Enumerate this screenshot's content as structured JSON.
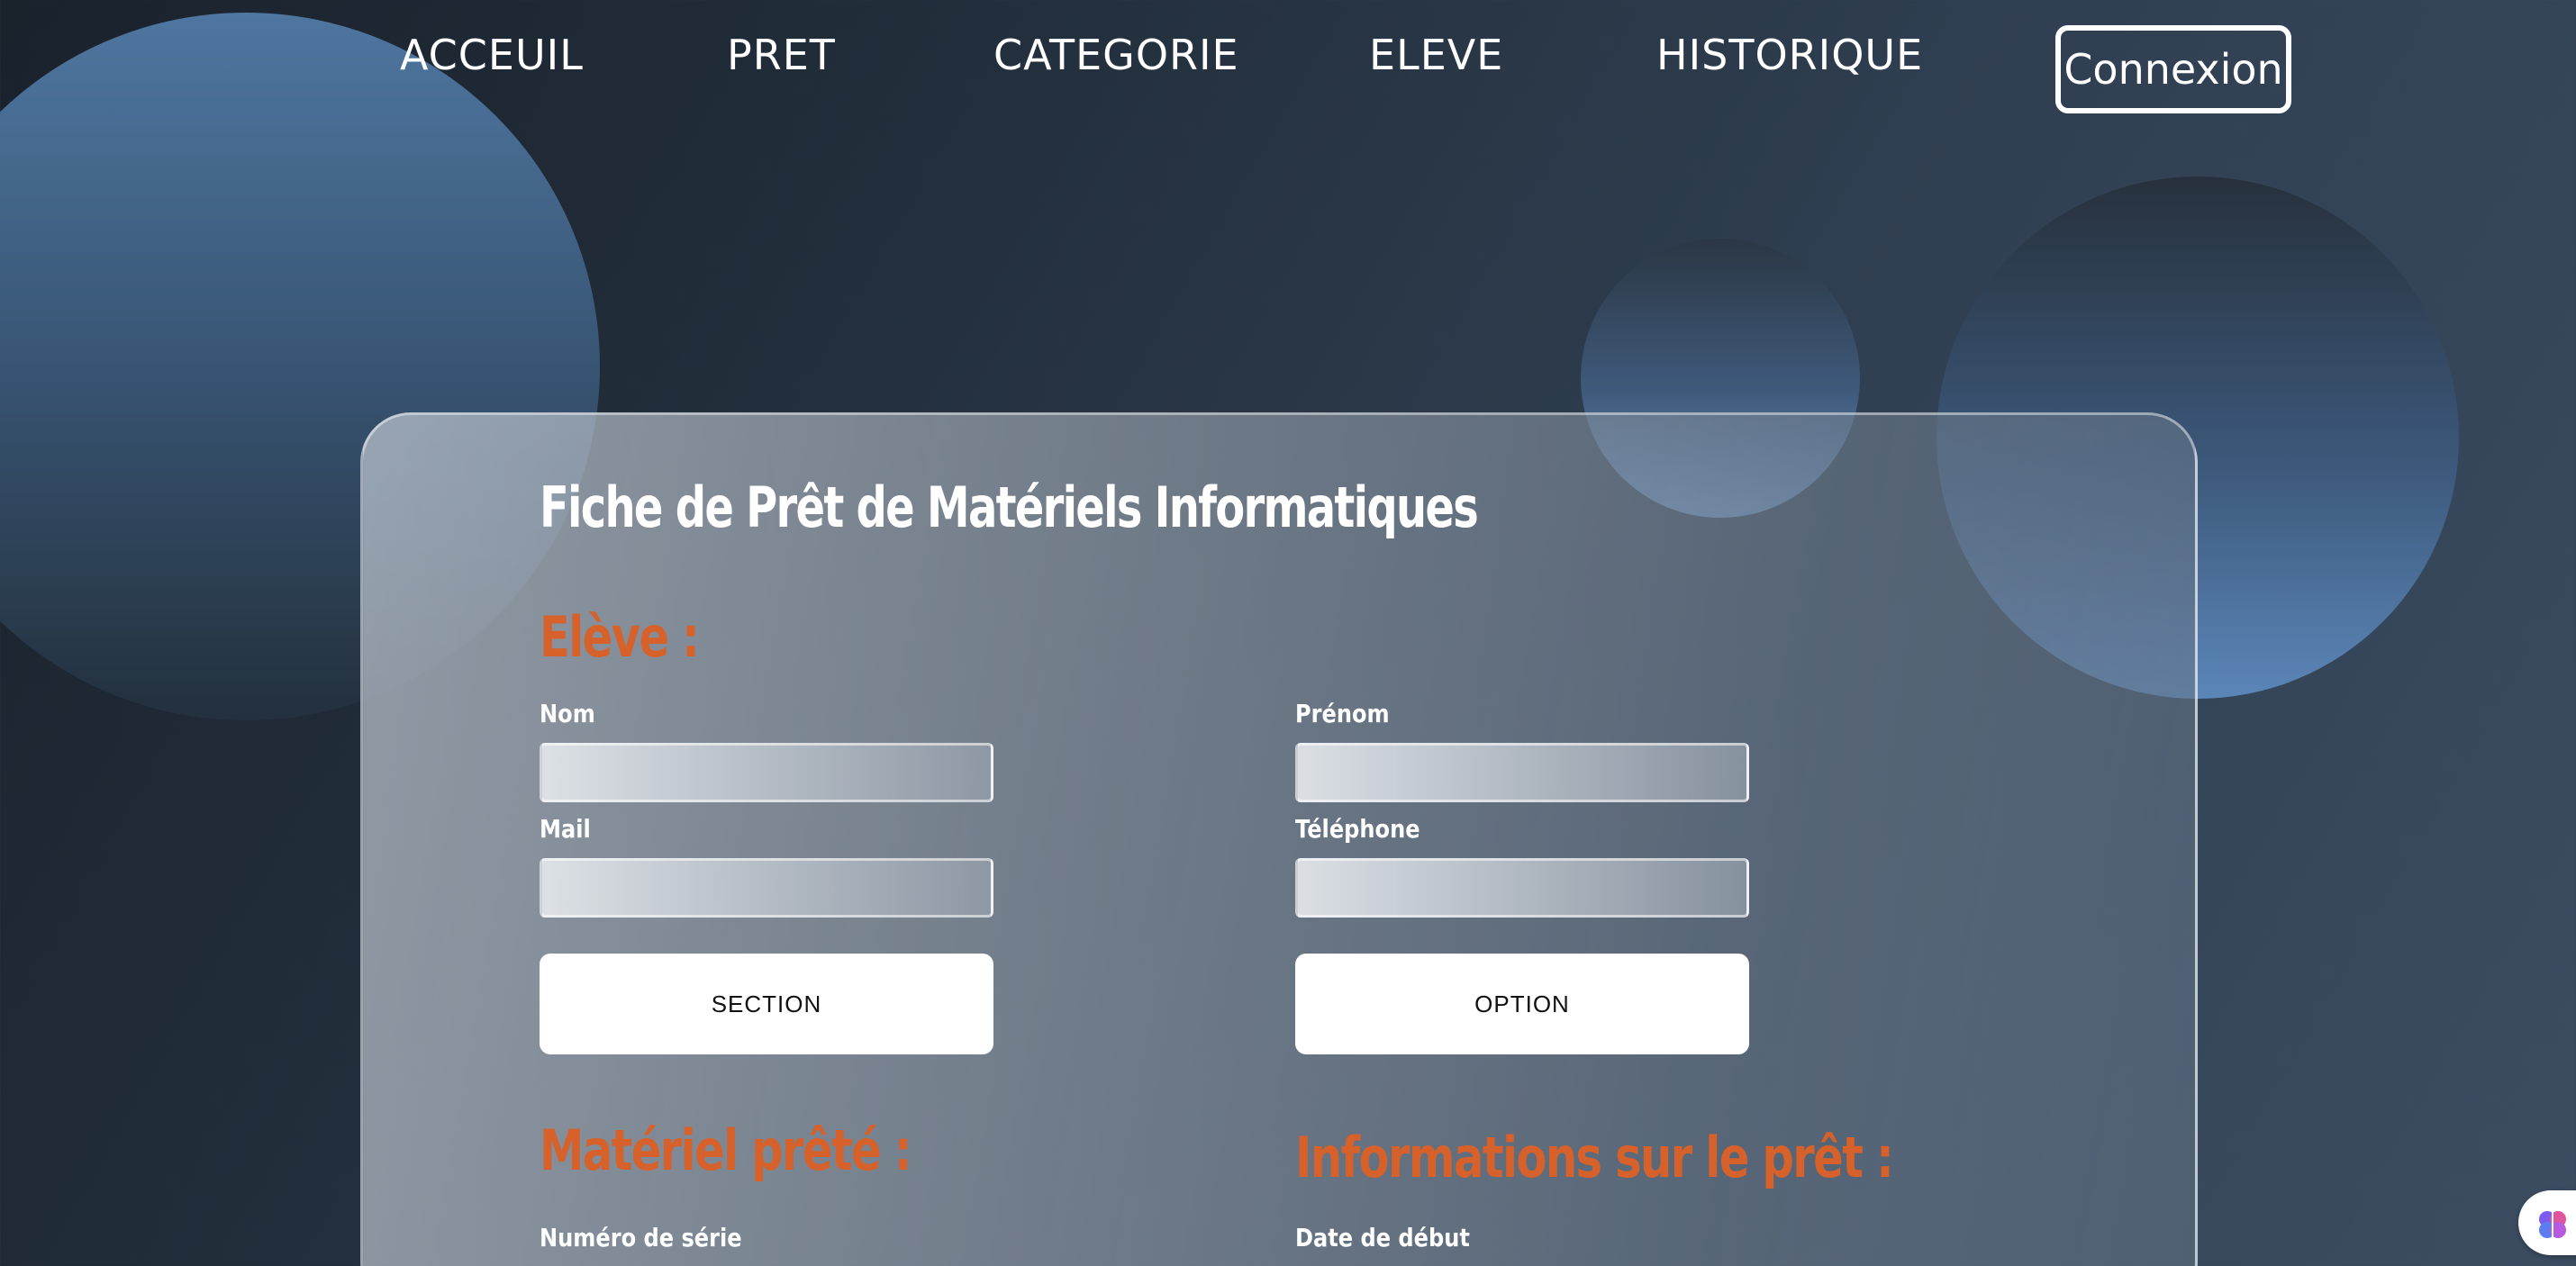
{
  "nav": {
    "links": [
      "ACCEUIL",
      "PRET",
      "CATEGORIE",
      "ELEVE",
      "HISTORIQUE"
    ],
    "login_label": "Connexion"
  },
  "form": {
    "title": "Fiche de Prêt de Matériels Informatiques",
    "student": {
      "heading": "Elève :",
      "nom_label": "Nom",
      "prenom_label": "Prénom",
      "mail_label": "Mail",
      "telephone_label": "Téléphone",
      "section_label": "SECTION",
      "option_label": "OPTION"
    },
    "material": {
      "heading": "Matériel prêté :",
      "serial_label": "Numéro de série"
    },
    "loan": {
      "heading": "Informations sur le prêt :",
      "start_date_label": "Date de début"
    }
  },
  "colors": {
    "accent": "#d7612a",
    "text": "#ffffff",
    "background": "#222e3b"
  },
  "icons": {
    "corner_widget": "brain-icon"
  }
}
